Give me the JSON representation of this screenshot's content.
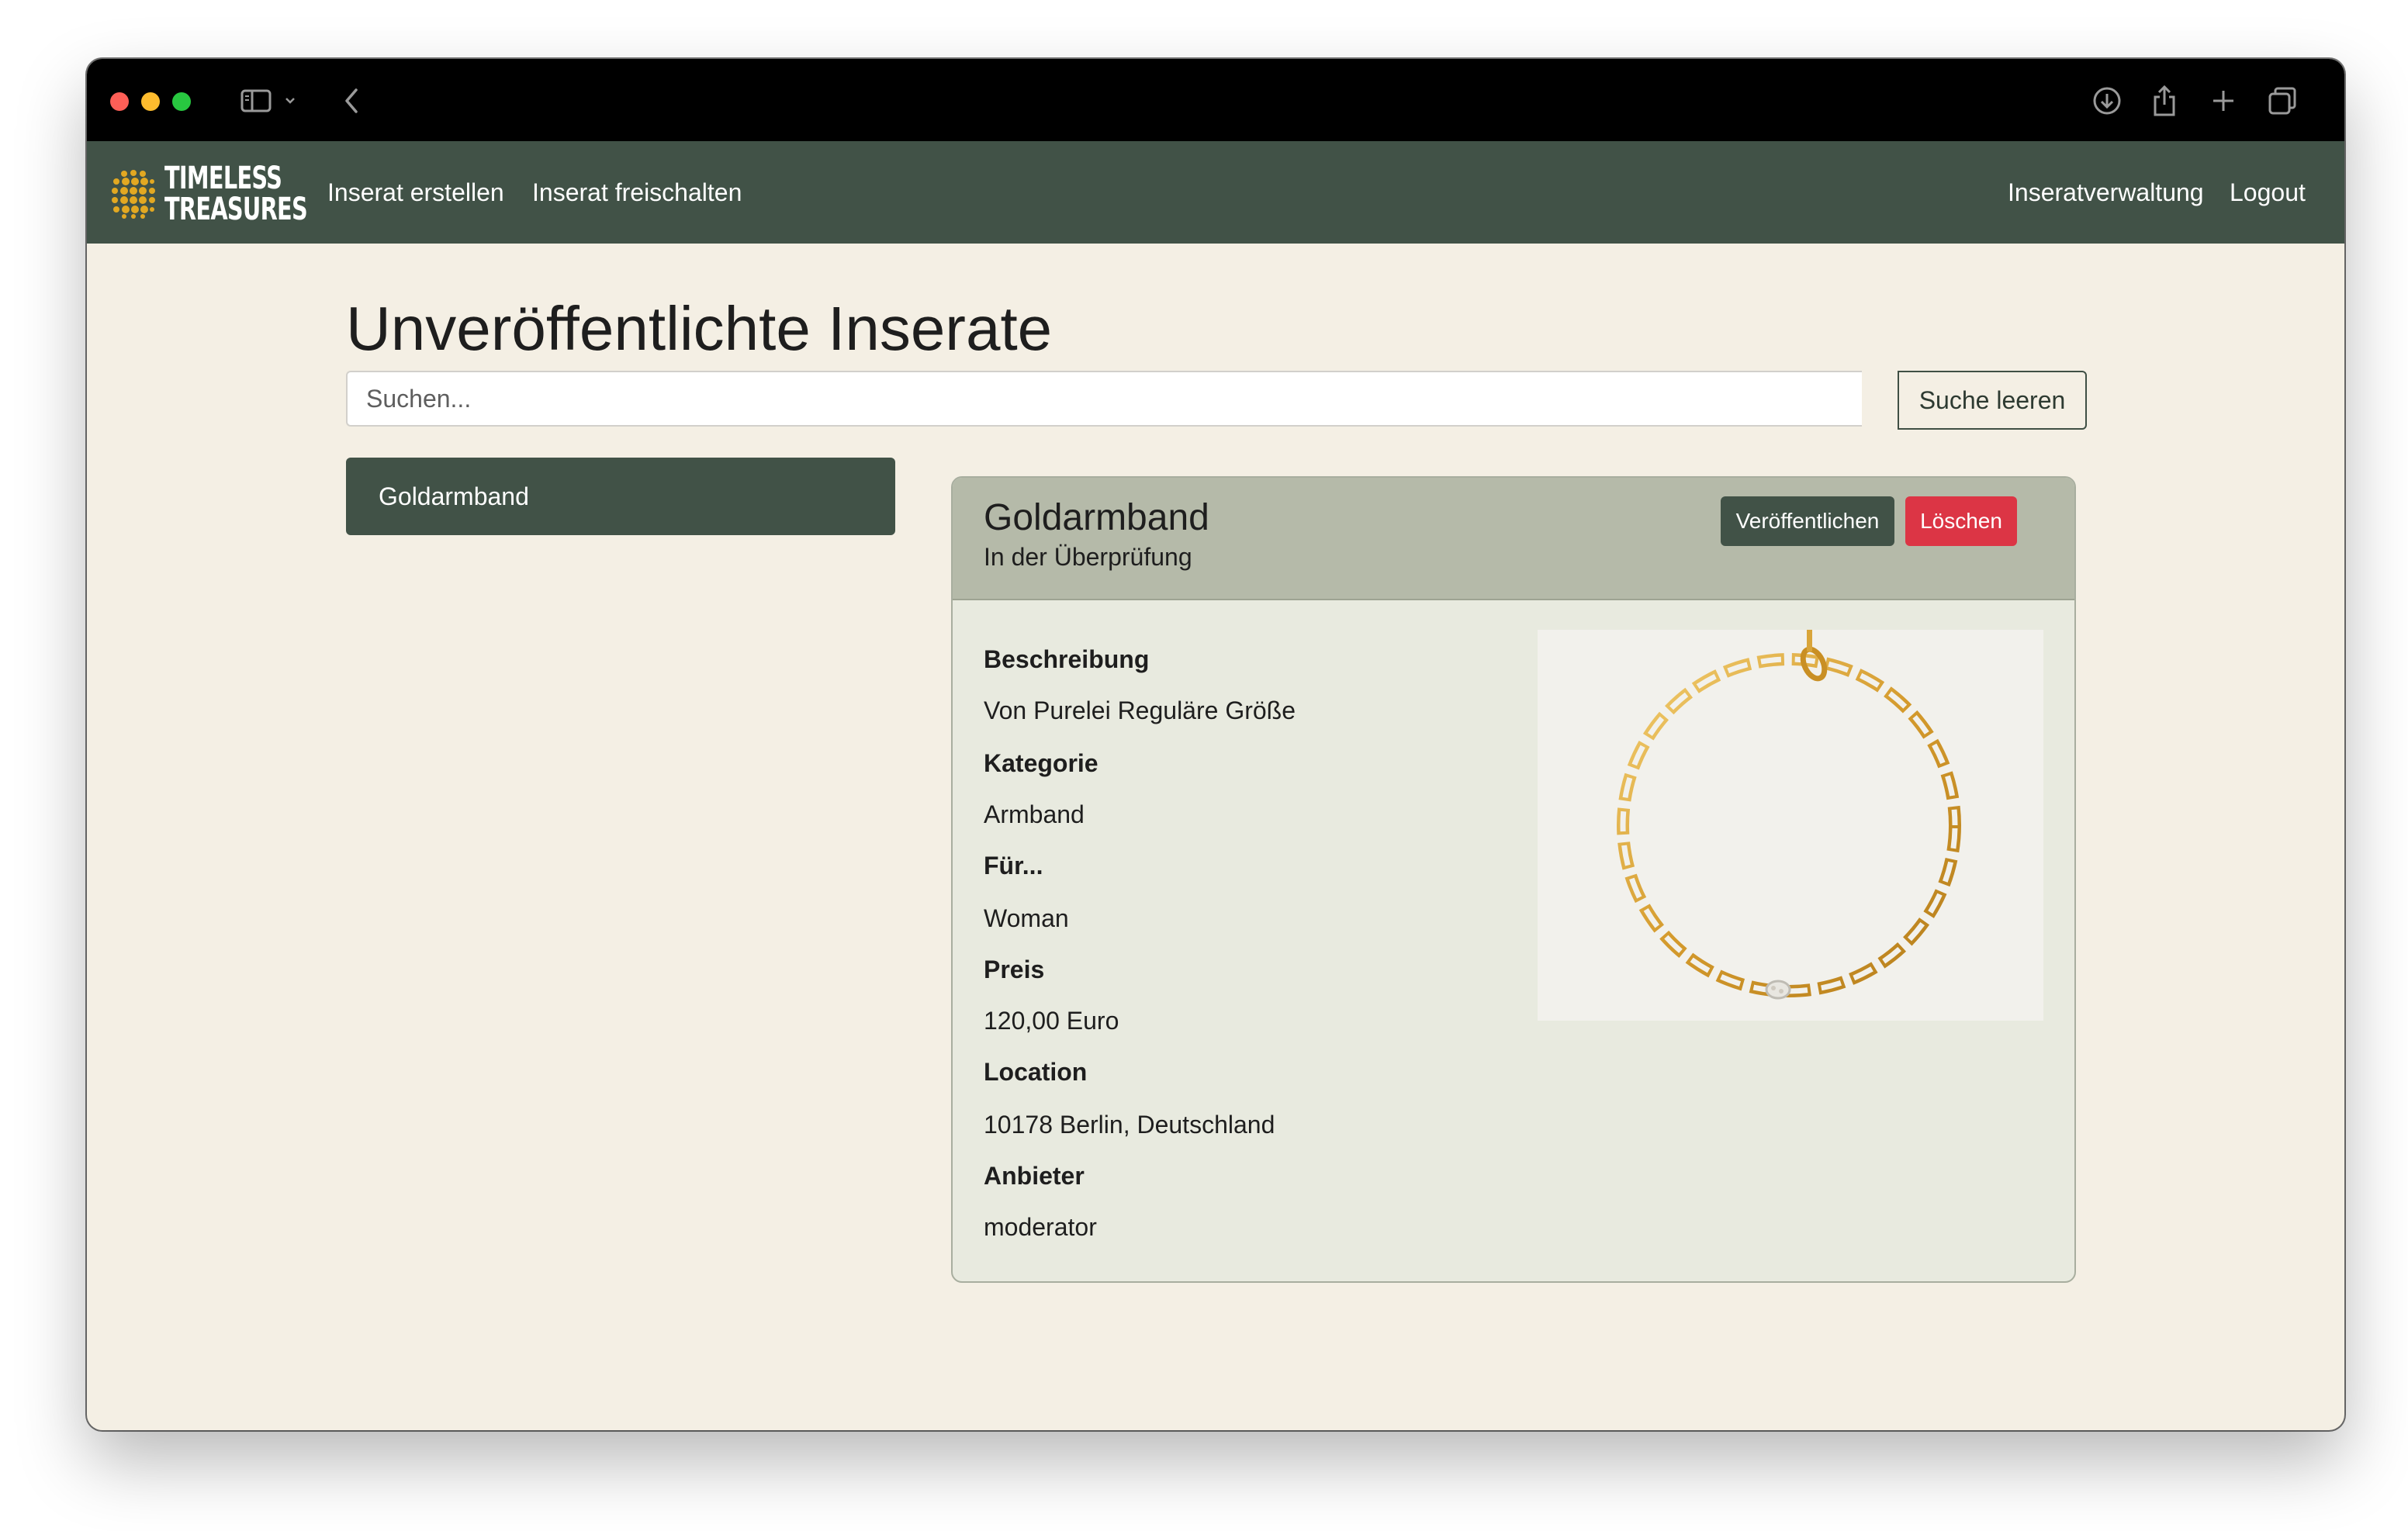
{
  "browser": {
    "traffic_lights": [
      "#fe5f57",
      "#febc2e",
      "#28c840"
    ],
    "icons": [
      "sidebar-icon",
      "chevron-down-icon",
      "back-icon",
      "download-icon",
      "share-icon",
      "new-tab-icon",
      "tabs-overview-icon"
    ]
  },
  "navbar": {
    "brand_line1": "TIMELESS",
    "brand_line2": "TREASURES",
    "links_left": [
      "Inserat erstellen",
      "Inserat freischalten"
    ],
    "links_right": [
      "Inseratverwaltung",
      "Logout"
    ]
  },
  "main": {
    "title": "Unveröffentlichte Inserate",
    "search": {
      "placeholder": "Suchen...",
      "value": "",
      "clear_label": "Suche leeren"
    },
    "list": [
      {
        "label": "Goldarmband",
        "active": true
      }
    ]
  },
  "detail": {
    "title": "Goldarmband",
    "status": "In der Überprüfung",
    "publish_label": "Veröffentlichen",
    "delete_label": "Löschen",
    "fields": [
      {
        "label": "Beschreibung",
        "value": "Von Purelei Reguläre Größe"
      },
      {
        "label": "Kategorie",
        "value": "Armband"
      },
      {
        "label": "Für...",
        "value": "Woman"
      },
      {
        "label": "Preis",
        "value": "120,00 Euro"
      },
      {
        "label": "Location",
        "value": "10178 Berlin, Deutschland"
      },
      {
        "label": "Anbieter",
        "value": "moderator"
      }
    ]
  },
  "colors": {
    "navbar": "#415247",
    "page_background": "#f4efe4",
    "card_header": "#b5baa9",
    "card_body": "#e8eadf",
    "danger": "#dc3545",
    "logo_gold": "#e2a822"
  }
}
